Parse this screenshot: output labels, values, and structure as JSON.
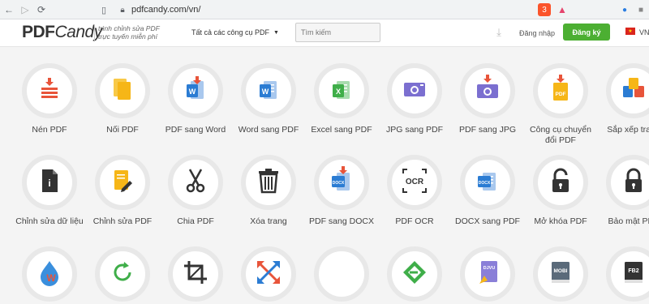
{
  "browser": {
    "url": "pdfcandy.com/vn/",
    "ext_brave_badge": "3"
  },
  "header": {
    "logo_pdf": "PDF",
    "logo_candy": "Candy",
    "tagline_line1": "trình chỉnh sửa PDF",
    "tagline_line2": "trực tuyến miễn phí",
    "tools_menu": "Tất cả các công cụ PDF",
    "search_placeholder": "Tìm kiếm",
    "login": "Đăng nhập",
    "signup": "Đăng ký",
    "lang": "VN"
  },
  "tools": [
    {
      "label": "Nén PDF",
      "icon": "compress-icon"
    },
    {
      "label": "Nối PDF",
      "icon": "merge-icon"
    },
    {
      "label": "PDF sang Word",
      "icon": "pdf-to-word-icon"
    },
    {
      "label": "Word sang PDF",
      "icon": "word-to-pdf-icon"
    },
    {
      "label": "Excel sang PDF",
      "icon": "excel-to-pdf-icon"
    },
    {
      "label": "JPG sang PDF",
      "icon": "jpg-to-pdf-icon"
    },
    {
      "label": "PDF sang JPG",
      "icon": "pdf-to-jpg-icon"
    },
    {
      "label": "Công cụ chuyển đổi PDF",
      "icon": "pdf-converter-icon"
    },
    {
      "label": "Sắp xếp trang",
      "icon": "organize-pages-icon"
    },
    {
      "label": "Chỉnh sửa dữ liệu",
      "icon": "edit-metadata-icon"
    },
    {
      "label": "Chỉnh sửa PDF",
      "icon": "edit-pdf-icon"
    },
    {
      "label": "Chia PDF",
      "icon": "scissors-icon"
    },
    {
      "label": "Xóa trang",
      "icon": "trash-icon"
    },
    {
      "label": "PDF sang DOCX",
      "icon": "pdf-to-docx-icon"
    },
    {
      "label": "PDF OCR",
      "icon": "ocr-icon"
    },
    {
      "label": "DOCX sang PDF",
      "icon": "docx-to-pdf-icon"
    },
    {
      "label": "Mở khóa PDF",
      "icon": "unlock-icon"
    },
    {
      "label": "Bảo mật PDF",
      "icon": "lock-icon"
    },
    {
      "label": "",
      "icon": "wps-icon"
    },
    {
      "label": "",
      "icon": "rotate-icon"
    },
    {
      "label": "",
      "icon": "crop-icon"
    },
    {
      "label": "",
      "icon": "resize-arrows-icon"
    },
    {
      "label": "",
      "icon": "html-code-icon"
    },
    {
      "label": "",
      "icon": "epub-icon"
    },
    {
      "label": "",
      "icon": "djvu-icon"
    },
    {
      "label": "",
      "icon": "mobi-icon"
    },
    {
      "label": "",
      "icon": "fb2-icon"
    }
  ],
  "icon_text": {
    "word_w": "W",
    "excel_x": "X",
    "ocr": "OCR",
    "docx": "DOCX",
    "pdf": "PDF",
    "djvu": "DJVU",
    "mobi": "MOBI",
    "fb2": "FB2",
    "code": "</>",
    "info": "i"
  },
  "colors": {
    "accent_red": "#e8543a",
    "word_blue": "#2b7cd3",
    "excel_green": "#3fae49",
    "jpg_purple": "#7b6fd0",
    "folder_yellow": "#f6b617",
    "signup_green": "#4caf32",
    "dark_icon": "#333333"
  }
}
